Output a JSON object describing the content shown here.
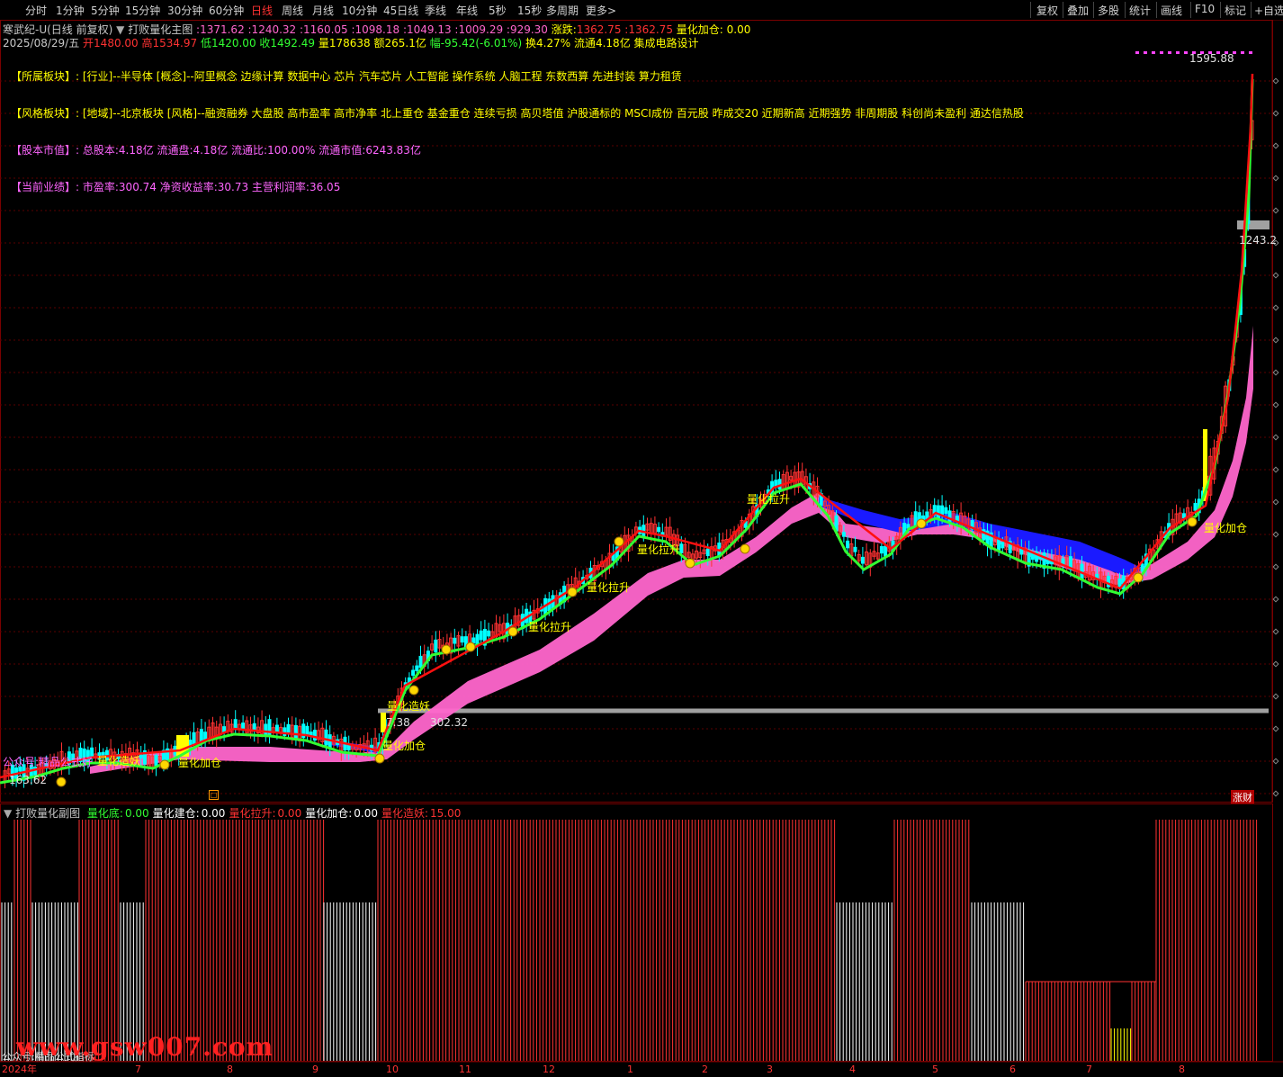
{
  "toolbar": {
    "periods": [
      "分时",
      "1分钟",
      "5分钟",
      "15分钟",
      "30分钟",
      "60分钟",
      "日线",
      "周线",
      "月线",
      "10分钟",
      "45日线",
      "季线",
      "年线",
      "5秒",
      "15秒",
      "多周期",
      "更多>"
    ],
    "active_index": 6,
    "right_buttons": [
      "复权",
      "叠加",
      "多股",
      "统计",
      "画线",
      "F10",
      "标记",
      "+自选"
    ]
  },
  "header": {
    "stock_name": "寒武纪-U(日线 前复权)",
    "indicator_name": "打败量化主图",
    "indicator_values": ":1371.62 :1240.32 :1160.05 :1098.18 :1049.13 :1009.29 :929.30",
    "zhangdie_label": "涨跌:",
    "zhangdie_value": "1362.75",
    "zhangdie_value2": ":1362.75",
    "lianghuajiacang_label": "量化加仓:",
    "lianghuajiacang_value": "0.00",
    "date": "2025/08/29/五",
    "open": "开1480.00",
    "high": "高1534.97",
    "low": "低1420.00",
    "close": "收1492.49",
    "volume": "量178638",
    "amount": "额265.1亿",
    "change": "幅-95.42(-6.01%)",
    "turnover": "换4.27%",
    "float": "流通4.18亿",
    "industry": "集成电路设计"
  },
  "info": {
    "sector_label": "【所属板块】:",
    "sector_text": "[行业]--半导体 [概念]--阿里概念 边缘计算 数据中心 芯片 汽车芯片 人工智能 操作系统 人脑工程 东数西算 先进封装 算力租赁",
    "style_label": "【风格板块】:",
    "style_text": "[地域]--北京板块 [风格]--融资融券 大盘股 高市盈率 高市净率 北上重仓 基金重仓 连续亏损 高贝塔值 沪股通标的 MSCI成份 百元股 昨成交20 近期新高 近期强势 非周期股 科创尚未盈利 通达信热股",
    "cap_label": "【股本市值】:",
    "cap_text": "总股本:4.18亿 流通盘:4.18亿 流通比:100.00% 流通市值:6243.83亿",
    "perf_label": "【当前业绩】:",
    "perf_text": "市盈率:300.74 净资收益率:30.73 主营利润率:36.05"
  },
  "annotations": {
    "max_price": "1595.88",
    "level_high": "1243.2",
    "level_low": "302.32",
    "level_low_prefix": "7.38",
    "min_price": "163.62",
    "watermark_main": "公众号:精品公式好",
    "zhangcai": "涨财",
    "signals": [
      "量化造妖",
      "量化加仓",
      "量化造妖",
      "量化加仓",
      "量化拉升",
      "量化拉升",
      "量化拉升",
      "量化拉升",
      "量化加仓"
    ]
  },
  "sub_header": {
    "name": "打败量化副图",
    "items": [
      {
        "label": "量化底:",
        "value": "0.00",
        "color": "#32ff32"
      },
      {
        "label": "量化建仓:",
        "value": "0.00",
        "color": "#ffffff"
      },
      {
        "label": "量化拉升:",
        "value": "0.00",
        "color": "#ff3232"
      },
      {
        "label": "量化加仓:",
        "value": "0.00",
        "color": "#ffffff"
      },
      {
        "label": "量化造妖:",
        "value": "15.00",
        "color": "#ff3232"
      }
    ]
  },
  "x_axis": {
    "labels": [
      "2024年",
      "7",
      "8",
      "9",
      "10",
      "11",
      "12",
      "1",
      "2",
      "3",
      "4",
      "5",
      "6",
      "7",
      "8"
    ]
  },
  "watermark_sub": "公众号:精品公式指标",
  "watermark_site": "www.gsw007.com",
  "colors": {
    "up": "#ff3232",
    "down": "#00ffff",
    "green_line": "#32ff32",
    "red_line": "#ff1010",
    "pink_band": "#ff66cc",
    "blue_band": "#1a1aff",
    "grid": "#5a0000",
    "gray_level": "#a0a0a0"
  },
  "chart_data": {
    "type": "candlestick",
    "series": [
      {
        "name": "量化造妖",
        "value": 15.0
      },
      {
        "name": "量化底",
        "value": 0.0
      },
      {
        "name": "量化建仓",
        "value": 0.0
      },
      {
        "name": "量化拉升",
        "value": 0.0
      },
      {
        "name": "量化加仓",
        "value": 0.0
      }
    ],
    "price_range": [
      163.62,
      1595.88
    ],
    "x_labels": [
      "2024年",
      "7",
      "8",
      "9",
      "10",
      "11",
      "12",
      "1",
      "2",
      "3",
      "4",
      "5",
      "6",
      "7",
      "8"
    ],
    "last_bar": {
      "date": "2025/08/29",
      "open": 1480.0,
      "high": 1534.97,
      "low": 1420.0,
      "close": 1492.49
    }
  }
}
